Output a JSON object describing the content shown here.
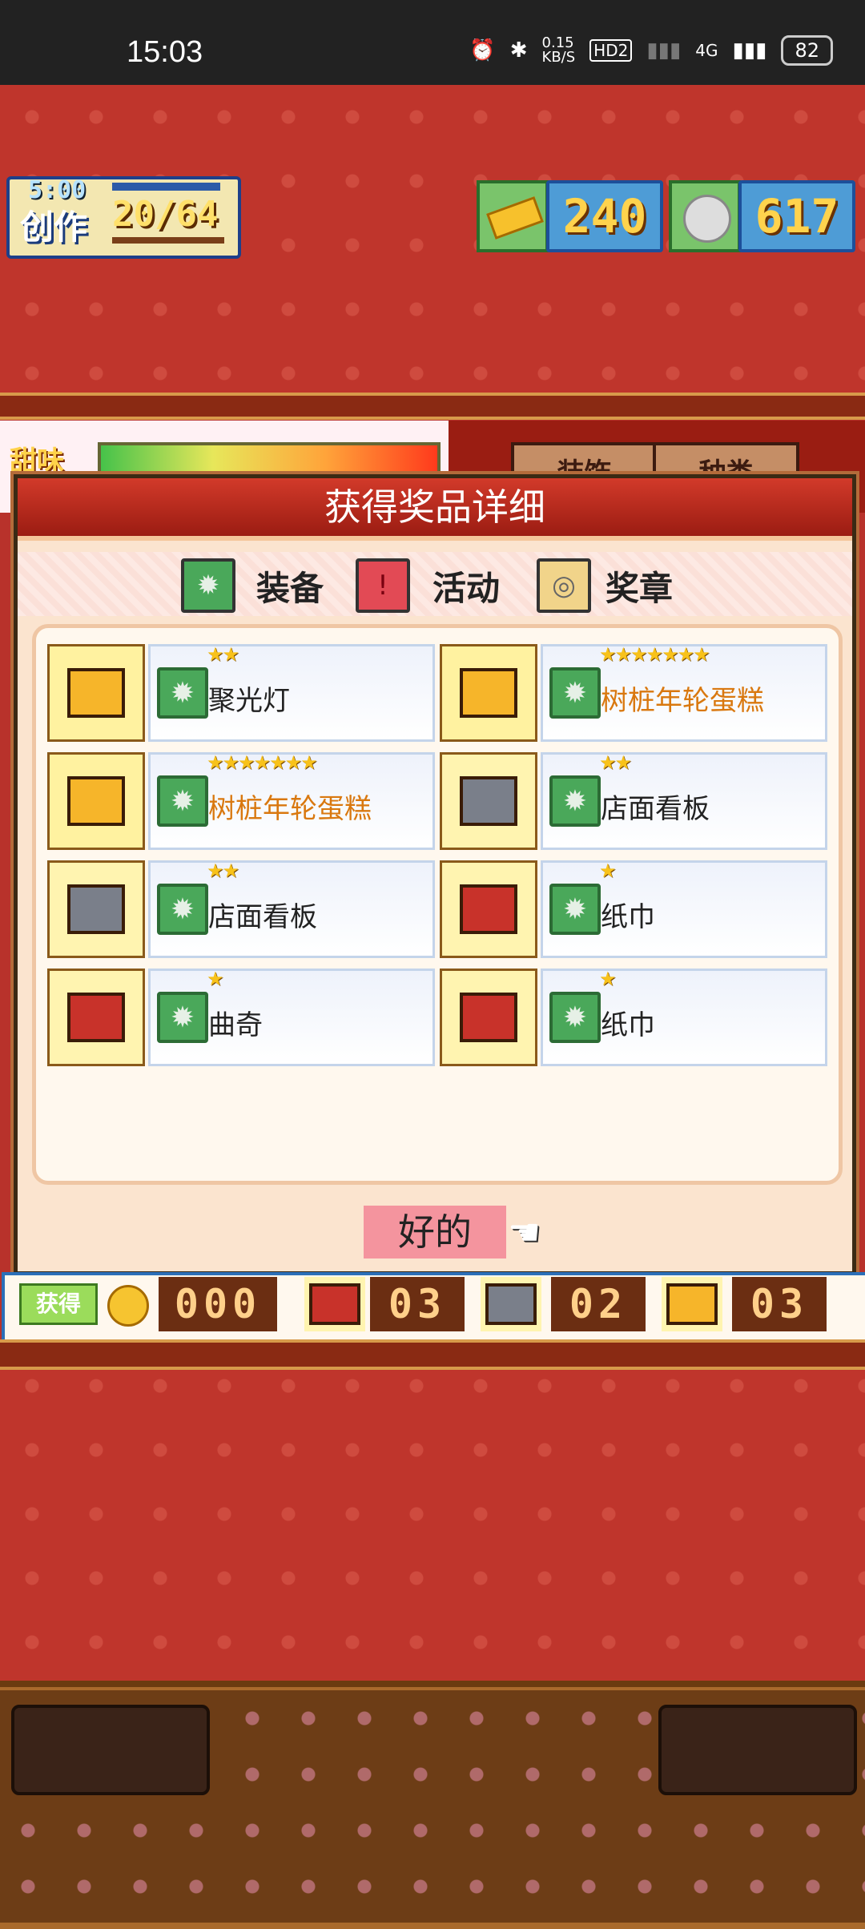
{
  "status_bar": {
    "time": "15:03",
    "net_speed": "0.15\nKB/S",
    "hd": "HD2",
    "signal": "4G",
    "battery": "82"
  },
  "hud": {
    "timer": "5:00",
    "create_label": "创作",
    "create_count": "20/64",
    "gold": "240",
    "silver": "617"
  },
  "behind": {
    "tab": "甜味",
    "tab1": "装饰",
    "tab2": "种类"
  },
  "dialog": {
    "title": "获得奖品详细",
    "legend": [
      {
        "icon": "gear-icon",
        "label": "装备",
        "color": "#4aa85a"
      },
      {
        "icon": "exclamation-icon",
        "label": "活动",
        "color": "#e24a55"
      },
      {
        "icon": "medal-icon",
        "label": "奖章",
        "color": "#c8c8c8"
      }
    ],
    "items": [
      {
        "name": "聚光灯",
        "stars": 2,
        "stars_text": "★★",
        "chest": "gold",
        "highlight": false
      },
      {
        "name": "树桩年轮蛋糕",
        "stars": 7,
        "stars_text": "★★★★★★★",
        "chest": "gold",
        "highlight": true
      },
      {
        "name": "树桩年轮蛋糕",
        "stars": 7,
        "stars_text": "★★★★★★★",
        "chest": "gold",
        "highlight": true
      },
      {
        "name": "店面看板",
        "stars": 2,
        "stars_text": "★★",
        "chest": "silver",
        "highlight": false
      },
      {
        "name": "店面看板",
        "stars": 2,
        "stars_text": "★★",
        "chest": "silver",
        "highlight": false
      },
      {
        "name": "纸巾",
        "stars": 1,
        "stars_text": "★",
        "chest": "red",
        "highlight": false
      },
      {
        "name": "曲奇",
        "stars": 1,
        "stars_text": "★",
        "chest": "red",
        "highlight": false
      },
      {
        "name": "纸巾",
        "stars": 1,
        "stars_text": "★",
        "chest": "red",
        "highlight": false
      }
    ],
    "ok_label": "好的"
  },
  "counter": {
    "label": "获得",
    "coins": "000",
    "red": "03",
    "silver": "02",
    "gold": "03"
  },
  "colors": {
    "bg": "#bf352c",
    "highlight_text": "#d9780f",
    "header": "#b5271b"
  }
}
